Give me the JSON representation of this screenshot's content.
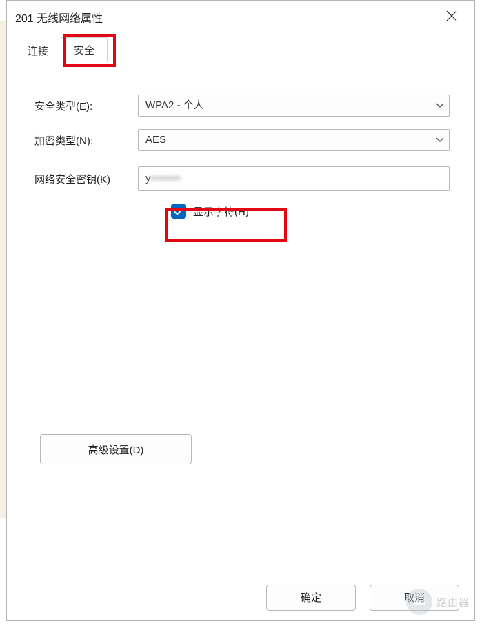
{
  "window": {
    "title": "201 无线网络属性"
  },
  "tabs": {
    "connection": "连接",
    "security": "安全"
  },
  "form": {
    "security_type_label": "安全类型(E):",
    "security_type_value": "WPA2 - 个人",
    "encryption_label": "加密类型(N):",
    "encryption_value": "AES",
    "key_label": "网络安全密钥(K)",
    "key_value_visible_prefix": "y",
    "key_value_obscured": "•••••••",
    "show_chars_label": "显示字符(H)",
    "show_chars_checked": true
  },
  "buttons": {
    "advanced": "高级设置(D)",
    "ok": "确定",
    "cancel": "取消"
  },
  "watermark": {
    "text": "路由器"
  }
}
